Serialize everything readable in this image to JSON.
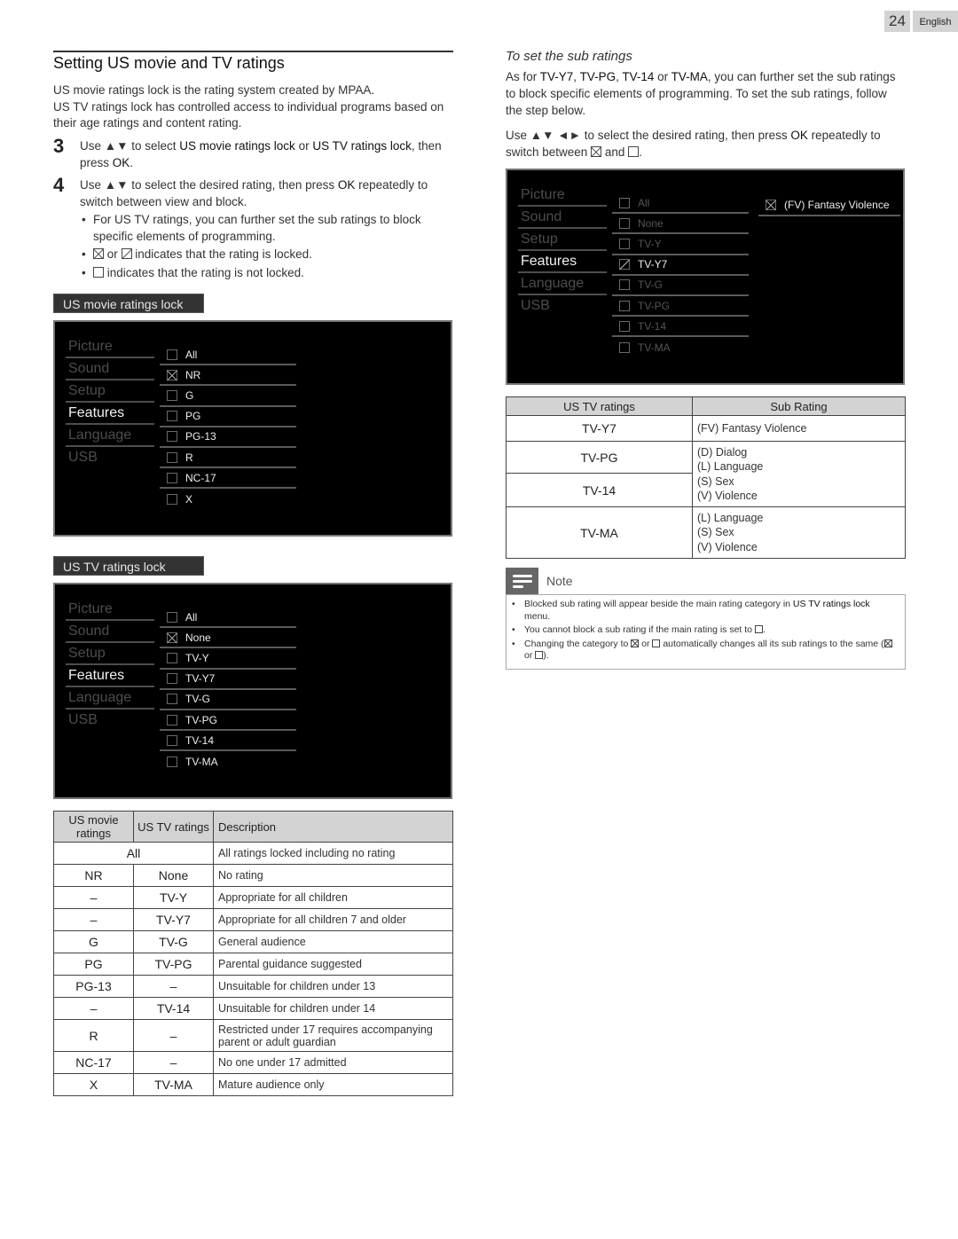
{
  "header": {
    "page_number": "24",
    "language_tab": "English"
  },
  "left": {
    "title": "Setting US movie and TV ratings",
    "intro": [
      "US movie ratings lock is the rating system created by MPAA.",
      "US TV ratings lock has controlled access to individual programs based on their age ratings and content rating."
    ],
    "step3": {
      "num": "3",
      "pre": "Use ▲▼ to select ",
      "opt1": "US movie ratings lock",
      "mid": " or ",
      "opt2": "US TV ratings lock",
      "post": ", then press ",
      "ok": "OK",
      "end": "."
    },
    "step4": {
      "num": "4",
      "pre": "Use ▲▼ to select the desired rating, then press ",
      "ok": "OK",
      "post": " repeatedly to switch between view and block.",
      "bullets": {
        "b1": "For US TV ratings, you can further set the sub ratings to block specific elements of programming.",
        "b2_mid": " or ",
        "b2_end": " indicates that the rating is locked.",
        "b3_end": " indicates that the rating is not locked."
      }
    },
    "movie_menu": {
      "label": "US movie ratings lock",
      "categories": [
        "Picture",
        "Sound",
        "Setup",
        "Features",
        "Language",
        "USB"
      ],
      "active_category": "Features",
      "options": [
        {
          "label": "All",
          "state": "unlocked"
        },
        {
          "label": "NR",
          "state": "locked"
        },
        {
          "label": "G",
          "state": "unlocked"
        },
        {
          "label": "PG",
          "state": "unlocked"
        },
        {
          "label": "PG-13",
          "state": "unlocked"
        },
        {
          "label": "R",
          "state": "unlocked"
        },
        {
          "label": "NC-17",
          "state": "unlocked"
        },
        {
          "label": "X",
          "state": "unlocked"
        }
      ]
    },
    "tv_menu": {
      "label": "US TV ratings lock",
      "categories": [
        "Picture",
        "Sound",
        "Setup",
        "Features",
        "Language",
        "USB"
      ],
      "active_category": "Features",
      "options": [
        {
          "label": "All",
          "state": "unlocked"
        },
        {
          "label": "None",
          "state": "locked"
        },
        {
          "label": "TV-Y",
          "state": "unlocked"
        },
        {
          "label": "TV-Y7",
          "state": "unlocked"
        },
        {
          "label": "TV-G",
          "state": "unlocked"
        },
        {
          "label": "TV-PG",
          "state": "unlocked"
        },
        {
          "label": "TV-14",
          "state": "unlocked"
        },
        {
          "label": "TV-MA",
          "state": "unlocked"
        }
      ]
    },
    "ratings_table": {
      "headers": [
        "US movie ratings",
        "US TV ratings",
        "Description"
      ],
      "rows": [
        [
          "All",
          "",
          "All ratings locked including no rating"
        ],
        [
          "NR",
          "None",
          "No rating"
        ],
        [
          "–",
          "TV-Y",
          "Appropriate for all children"
        ],
        [
          "–",
          "TV-Y7",
          "Appropriate for all children 7 and older"
        ],
        [
          "G",
          "TV-G",
          "General audience"
        ],
        [
          "PG",
          "TV-PG",
          "Parental guidance suggested"
        ],
        [
          "PG-13",
          "–",
          "Unsuitable for children under 13"
        ],
        [
          "–",
          "TV-14",
          "Unsuitable for children under 14"
        ],
        [
          "R",
          "–",
          "Restricted under 17 requires accompanying parent or adult guardian"
        ],
        [
          "NC-17",
          "–",
          "No one under 17 admitted"
        ],
        [
          "X",
          "TV-MA",
          "Mature audience only"
        ]
      ]
    }
  },
  "right": {
    "subtitle": "To set the sub ratings",
    "para1": {
      "pre": "As for ",
      "r1": "TV-Y7",
      "s1": ", ",
      "r2": "TV-PG",
      "s2": ", ",
      "r3": "TV-14",
      "s3": " or ",
      "r4": "TV-MA",
      "post": ", you can further set the sub ratings to block specific elements of programming. To set the sub ratings, follow the step below."
    },
    "para2": {
      "pre": "Use ▲▼ ◄► to select the desired rating, then press ",
      "ok": "OK",
      "post": " repeatedly to switch between ",
      "and": " and ",
      "end": "."
    },
    "sub_menu": {
      "categories": [
        "Picture",
        "Sound",
        "Setup",
        "Features",
        "Language",
        "USB"
      ],
      "active_category": "Features",
      "options": [
        {
          "label": "All",
          "state": "unlocked",
          "dim": true
        },
        {
          "label": "None",
          "state": "unlocked",
          "dim": true
        },
        {
          "label": "TV-Y",
          "state": "unlocked",
          "dim": true
        },
        {
          "label": "TV-Y7",
          "state": "partial",
          "dim": false
        },
        {
          "label": "TV-G",
          "state": "unlocked",
          "dim": true
        },
        {
          "label": "TV-PG",
          "state": "unlocked",
          "dim": true
        },
        {
          "label": "TV-14",
          "state": "unlocked",
          "dim": true
        },
        {
          "label": "TV-MA",
          "state": "unlocked",
          "dim": true
        }
      ],
      "sub_option": {
        "label": "(FV) Fantasy Violence",
        "state": "locked"
      }
    },
    "sub_table": {
      "headers": [
        "US TV ratings",
        "Sub Rating"
      ],
      "rows": [
        {
          "rating": "TV-Y7",
          "subs": [
            "(FV) Fantasy Violence"
          ]
        },
        {
          "rating": "TV-PG",
          "subs": [
            "(D) Dialog",
            "(L) Language",
            "(S) Sex",
            "(V) Violence"
          ]
        },
        {
          "rating": "TV-14",
          "subs": []
        },
        {
          "rating": "TV-MA",
          "subs": [
            "(L) Language",
            "(S) Sex",
            "(V) Violence"
          ]
        }
      ]
    },
    "note": {
      "title": "Note",
      "items": {
        "n1_pre": "Blocked sub rating will appear beside the main rating category in ",
        "n1_bold": "US TV ratings lock",
        "n1_post": " menu.",
        "n2_pre": "You cannot block a sub rating if the main rating is set to ",
        "n2_post": ".",
        "n3_pre": "Changing the category to ",
        "n3_or": " or ",
        "n3_post": " automatically changes all its sub ratings to the same (",
        "n3_or2": " or ",
        "n3_end": ")."
      }
    }
  }
}
